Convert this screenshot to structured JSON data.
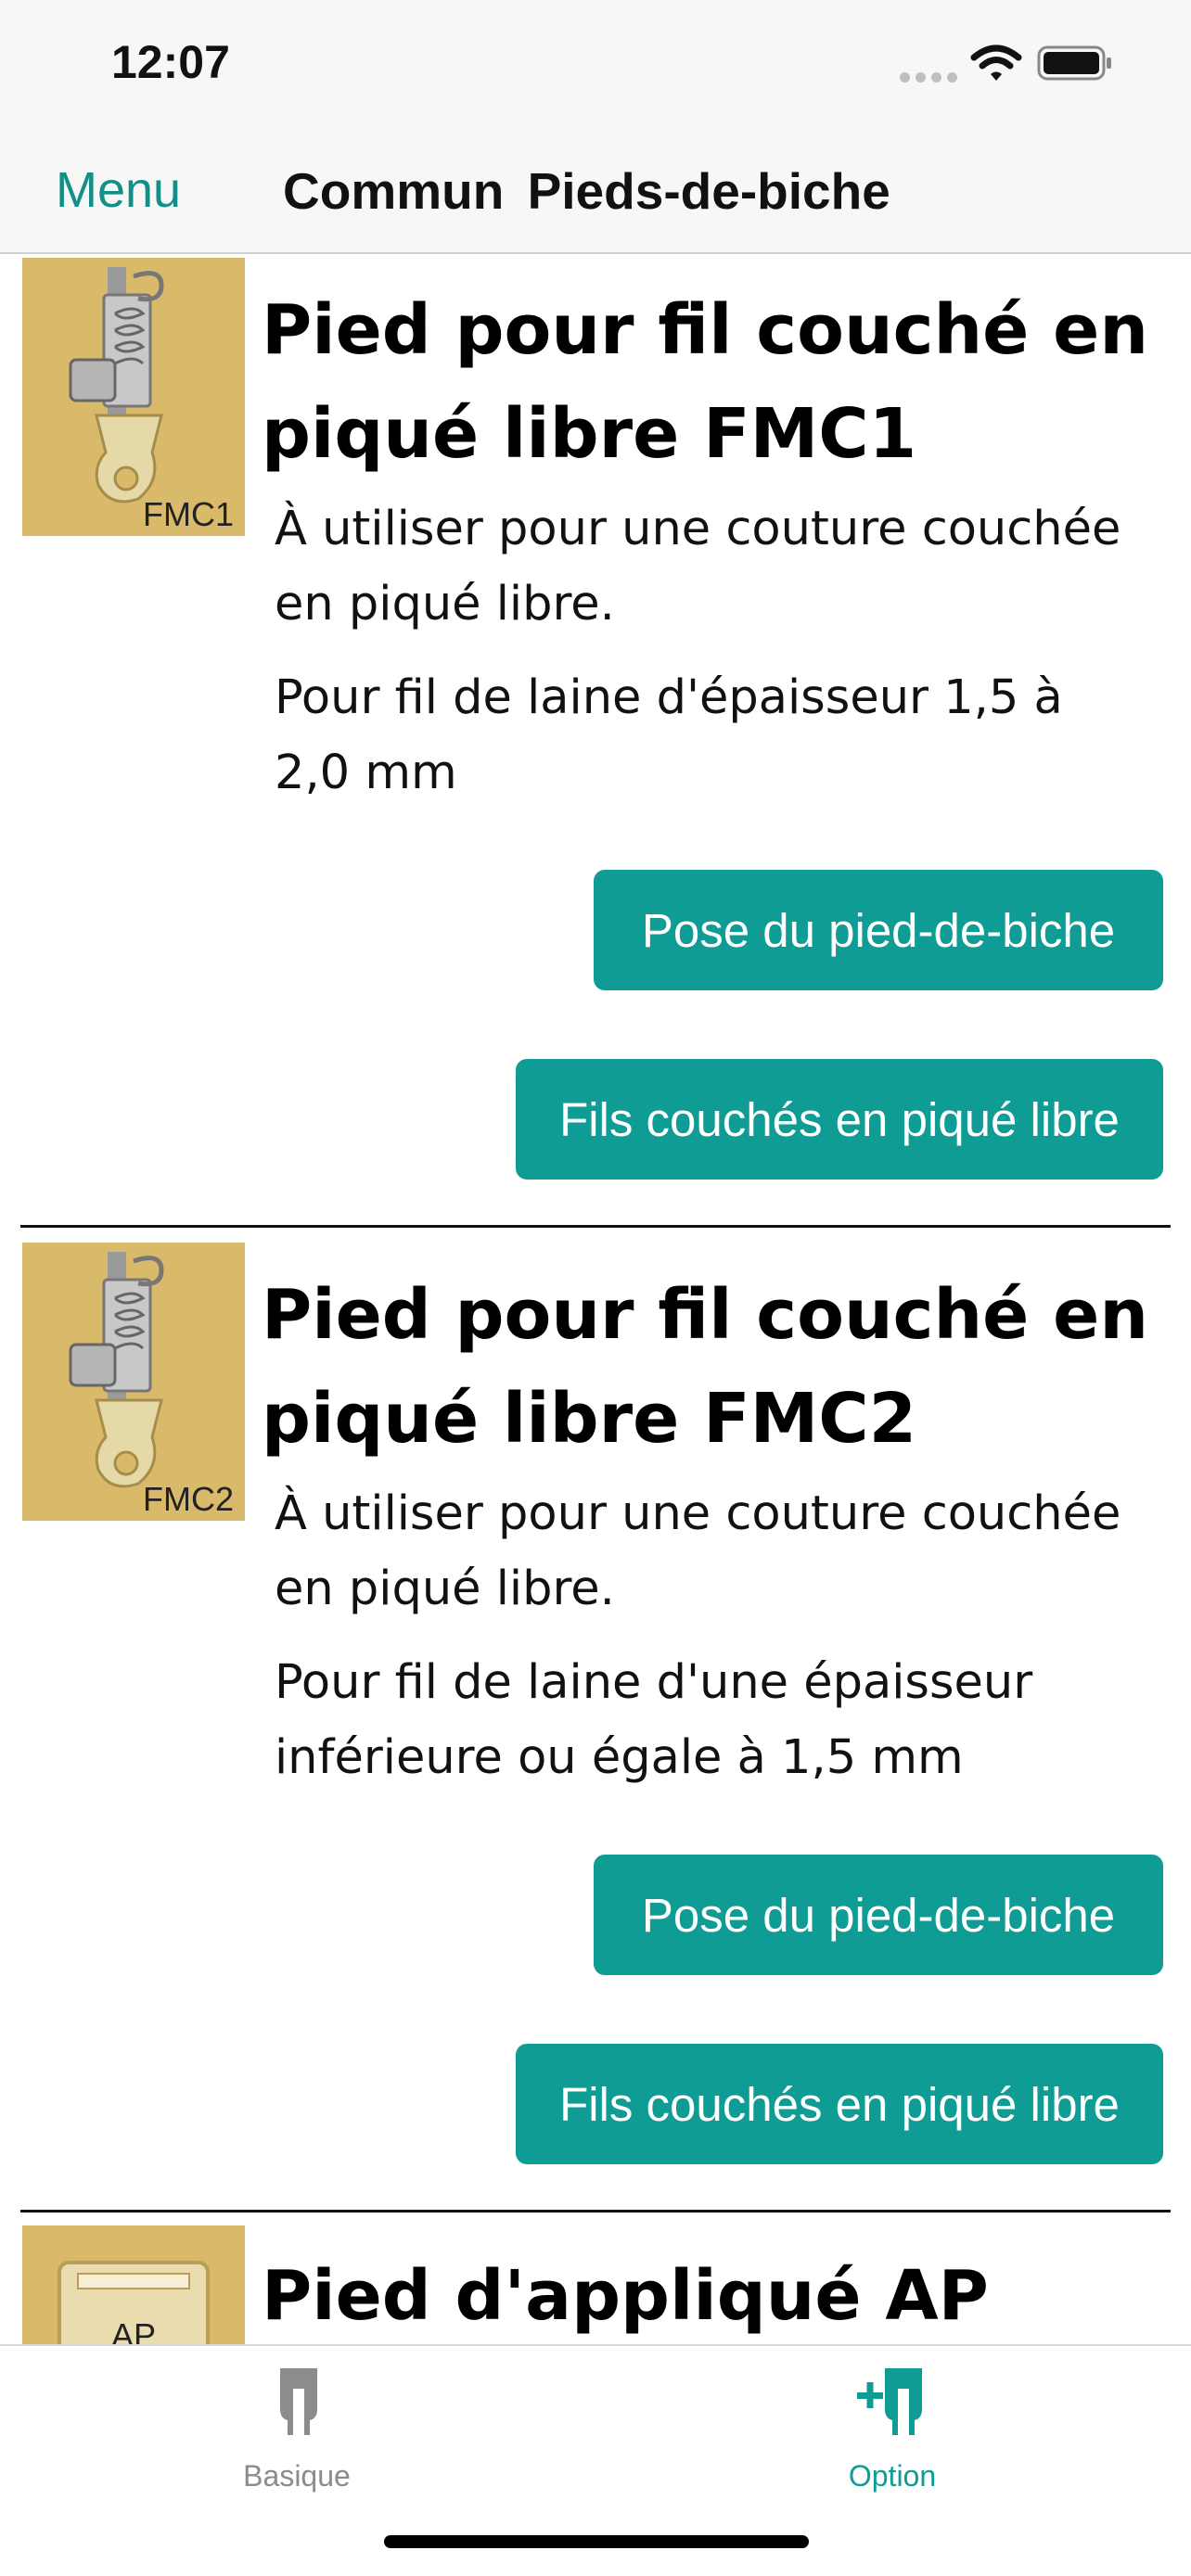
{
  "status_bar": {
    "time": "12:07",
    "icons": [
      "signal-dots-icon",
      "wifi-icon",
      "battery-icon"
    ]
  },
  "nav": {
    "menu_label": "Menu",
    "title": "Commun  Pieds-de-biche"
  },
  "items": [
    {
      "thumb_label": "FMC1",
      "title": "Pied pour fil couché en piqué libre FMC1",
      "description": "À utiliser pour une couture couchée en piqué libre.",
      "note": "Pour fil de laine d'épaisseur 1,5 à 2,0 mm",
      "button1": "Pose du pied-de-biche",
      "button2": "Fils couchés en piqué libre"
    },
    {
      "thumb_label": "FMC2",
      "title": "Pied pour fil couché en piqué libre FMC2",
      "description": "À utiliser pour une couture couchée en piqué libre.",
      "note": "Pour fil de laine d'une épaisseur inférieure ou égale à 1,5 mm",
      "button1": "Pose du pied-de-biche",
      "button2": "Fils couchés en piqué libre"
    },
    {
      "thumb_label": "AP",
      "title": "Pied d'appliqué AP"
    }
  ],
  "tabs": [
    {
      "label": "Basique",
      "icon": "presser-foot-icon",
      "selected": false
    },
    {
      "label": "Option",
      "icon": "add-presser-foot-icon",
      "selected": true
    }
  ],
  "colors": {
    "accent": "#0f9c94",
    "thumb_background": "#d9b96a",
    "bar_background": "#f7f7f7"
  }
}
